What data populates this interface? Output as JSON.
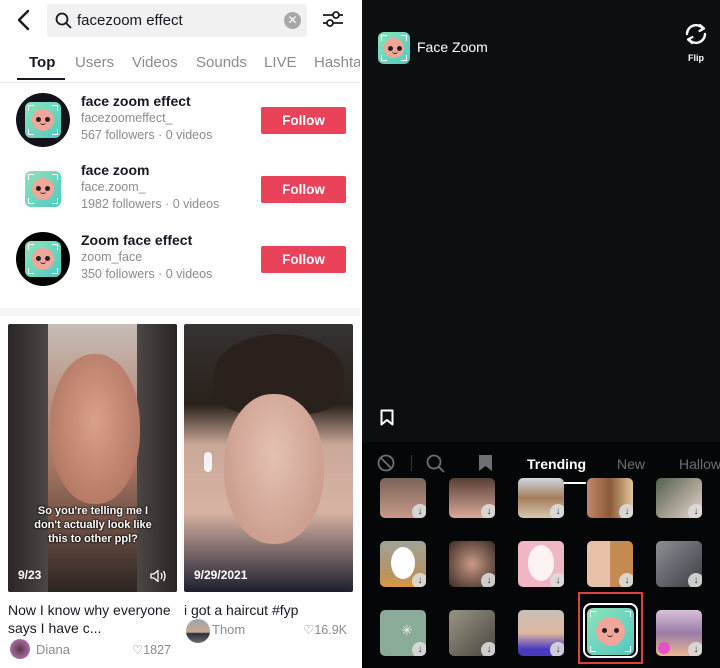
{
  "search": {
    "query": "facezoom effect",
    "back_icon": "chevron-left-icon",
    "search_icon": "magnifier-icon",
    "clear_icon": "close-circle-icon",
    "filter_icon": "sliders-icon"
  },
  "tabs": [
    {
      "label": "Top",
      "active": true
    },
    {
      "label": "Users",
      "active": false
    },
    {
      "label": "Videos",
      "active": false
    },
    {
      "label": "Sounds",
      "active": false
    },
    {
      "label": "LIVE",
      "active": false
    },
    {
      "label": "Hashtags",
      "active": false
    }
  ],
  "users": [
    {
      "name": "face zoom effect",
      "handle": "facezoomeffect_",
      "stats": "567 followers · 0 videos",
      "follow_label": "Follow"
    },
    {
      "name": "face zoom",
      "handle": "face.zoom_",
      "stats": "1982 followers · 0 videos",
      "follow_label": "Follow"
    },
    {
      "name": "Zoom face effect",
      "handle": "zoom_face",
      "stats": "350 followers · 0 videos",
      "follow_label": "Follow"
    }
  ],
  "videos": [
    {
      "date": "9/23",
      "overlay_text": "So you're telling me I don't actually look like this to other ppl?",
      "caption": "Now I know why everyone says I have c...",
      "author": "Diana",
      "likes": "1827",
      "has_sound_icon": true
    },
    {
      "date": "9/29/2021",
      "overlay_text": "",
      "caption": "i got a haircut #fyp",
      "author": "Thom",
      "likes": "16.9K",
      "has_sound_icon": false
    }
  ],
  "camera": {
    "effect_name": "Face Zoom",
    "flip_label": "Flip",
    "tray_tabs": [
      "Trending",
      "New",
      "Halloween"
    ],
    "active_tray_tab": "Trending",
    "selected_effect": "Face Zoom",
    "like_icon": "heart-outline-icon",
    "download_icon": "arrow-down-icon"
  },
  "colors": {
    "follow": "#ea4359",
    "selection_highlight": "#e0403c"
  }
}
